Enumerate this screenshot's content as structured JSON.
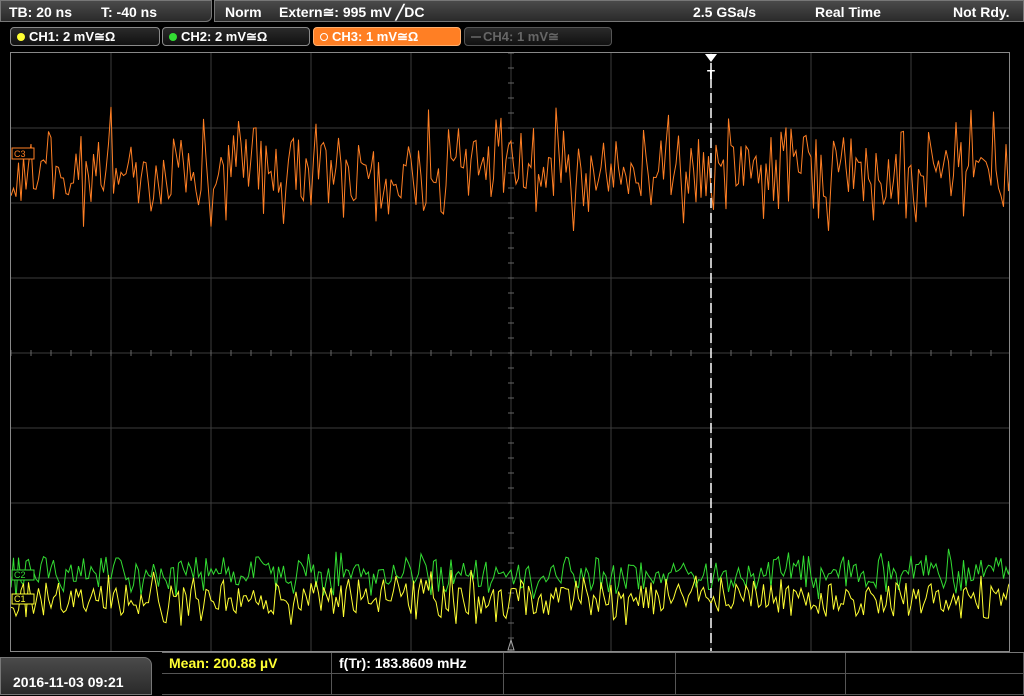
{
  "status_bar": {
    "timebase": "TB: 20 ns",
    "trigger_time": "T: -40 ns",
    "trigger_mode": "Norm",
    "trigger_source": "Extern≅: 995 mV ╱DC",
    "sample_rate": "2.5 GSa/s",
    "acq_mode": "Real Time",
    "status": "Not Rdy."
  },
  "channels": [
    {
      "label": "CH1: 2 mV≅Ω",
      "color": "#ffff33",
      "state": "on"
    },
    {
      "label": "CH2: 2 mV≅Ω",
      "color": "#33dd33",
      "state": "on"
    },
    {
      "label": "CH3: 1 mV≅Ω",
      "color": "#ff7f24",
      "state": "selected"
    },
    {
      "label": "CH4: 1 mV≅",
      "color": "#666666",
      "state": "off"
    }
  ],
  "markers": {
    "ch3": "C3",
    "ch2": "C2",
    "ch1": "C1",
    "trigger": "T"
  },
  "measurements": {
    "mean": "Mean: 200.88 µV",
    "freq": "f(Tr): 183.8609 mHz"
  },
  "datetime": "2016-11-03 09:21",
  "colors": {
    "ch1": "#ffff33",
    "ch2": "#33dd33",
    "ch3": "#ff7f24",
    "grid": "#3c3c3c"
  }
}
